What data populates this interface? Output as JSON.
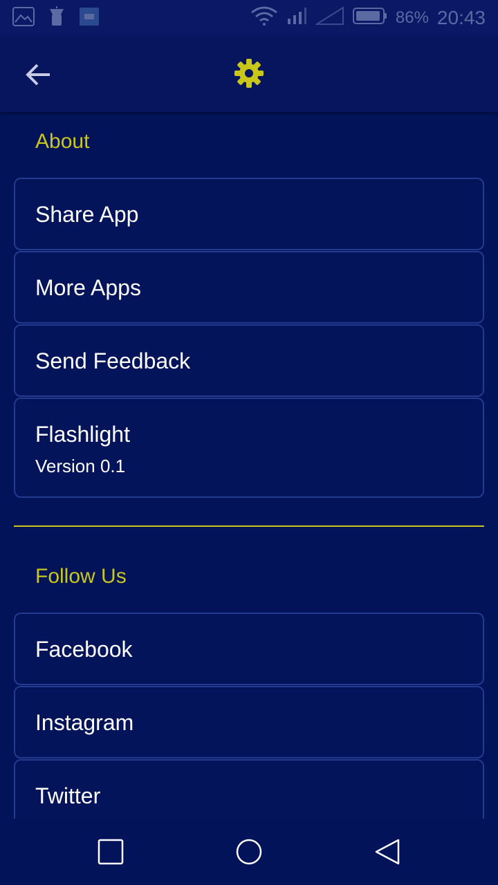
{
  "status_bar": {
    "battery": "86%",
    "time": "20:43",
    "icons": [
      "gallery-icon",
      "flashlight-icon",
      "app-icon",
      "wifi-icon",
      "signal-icon",
      "signal-2-icon",
      "battery-icon"
    ]
  },
  "app_bar": {
    "back_icon": "arrow-left-icon",
    "title_icon": "gear-icon",
    "accent": "#c9c81a"
  },
  "about": {
    "title": "About",
    "items": [
      {
        "label": "Share App"
      },
      {
        "label": "More Apps"
      },
      {
        "label": "Send Feedback"
      },
      {
        "label": "Flashlight",
        "sub": "Version 0.1"
      }
    ]
  },
  "follow": {
    "title": "Follow Us",
    "items": [
      {
        "label": "Facebook"
      },
      {
        "label": "Instagram"
      },
      {
        "label": "Twitter"
      }
    ]
  },
  "nav_bar": {
    "icons": [
      "recents-icon",
      "home-icon",
      "back-triangle-icon"
    ]
  }
}
